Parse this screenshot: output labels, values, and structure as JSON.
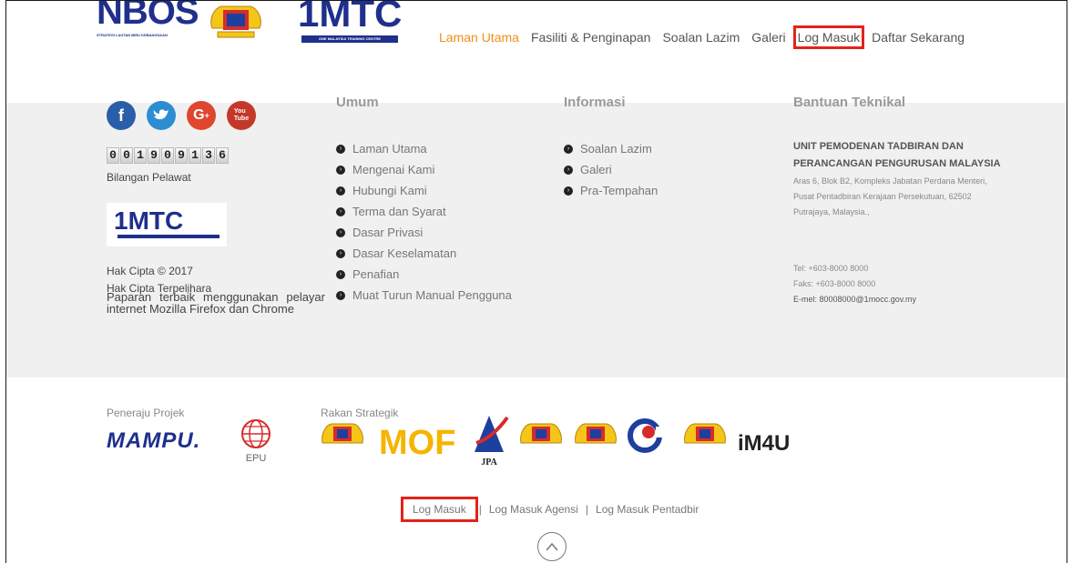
{
  "header": {
    "nbos_logo": {
      "text": "NBOS",
      "subtitle": "STRATEGI LAUTAN BIRU KEBANGSAAN"
    },
    "mtc_logo": {
      "text": "1MTC",
      "subtitle": "ONE MALAYSIA TRAINING CENTRE"
    },
    "nav": [
      {
        "label": "Laman Utama",
        "active": true
      },
      {
        "label": "Fasiliti & Penginapan"
      },
      {
        "label": "Soalan Lazim"
      },
      {
        "label": "Galeri"
      },
      {
        "label": "Log Masuk",
        "highlighted": true
      },
      {
        "label": "Daftar Sekarang"
      }
    ]
  },
  "footer": {
    "social": [
      {
        "name": "facebook-icon",
        "glyph": "f",
        "color": "#2a5ea8"
      },
      {
        "name": "twitter-icon",
        "glyph": "t",
        "color": "#2d8dd2"
      },
      {
        "name": "google-plus-icon",
        "glyph": "G+",
        "color": "#e0452f"
      },
      {
        "name": "youtube-icon",
        "glyph": "You Tube",
        "color": "#c4382a"
      }
    ],
    "counter_digits": [
      "0",
      "0",
      "1",
      "9",
      "0",
      "9",
      "1",
      "3",
      "6"
    ],
    "visitors_label": "Bilangan Pelawat",
    "mtc_small": "1MTC",
    "copyright_1": "Hak Cipta © 2017",
    "copyright_2": "Hak Cipta Terpelihara",
    "best_view": "Paparan terbaik menggunakan pelayar internet Mozilla Firefox dan Chrome",
    "umum": {
      "title": "Umum",
      "items": [
        "Laman Utama",
        "Mengenai Kami",
        "Hubungi Kami",
        "Terma dan Syarat",
        "Dasar Privasi",
        "Dasar Keselamatan",
        "Penafian",
        "Muat Turun Manual Pengguna"
      ]
    },
    "informasi": {
      "title": "Informasi",
      "items": [
        "Soalan Lazim",
        "Galeri",
        "Pra-Tempahan"
      ]
    },
    "bantuan": {
      "title": "Bantuan Teknikal",
      "org": "UNIT PEMODENAN TADBIRAN DAN PERANCANGAN PENGURUSAN MALAYSIA",
      "address": "Aras 6, Blok B2, Kompleks Jabatan Perdana Menteri, Pusat Pentadbiran Kerajaan Persekutuan, 62502 Putrajaya, Malaysia.,",
      "tel": "Tel: +603-8000 8000",
      "faks": "Faks: +603-8000 8000",
      "emel": "E-mel: 80008000@1mocc.gov.my"
    },
    "peneraju_label": "Peneraju Projek",
    "rakan_label": "Rakan Strategik",
    "mampu_logo": "MAMPU.",
    "epu_logo": "EPU",
    "partners": [
      "crest",
      "MOF",
      "JPA",
      "crest",
      "crest",
      "swirl",
      "crest",
      "iM4U"
    ],
    "bottom_links": [
      "Log Masuk",
      "Log Masuk Agensi",
      "Log Masuk Pentadbir"
    ],
    "separator": "|",
    "up_glyph": "^"
  }
}
